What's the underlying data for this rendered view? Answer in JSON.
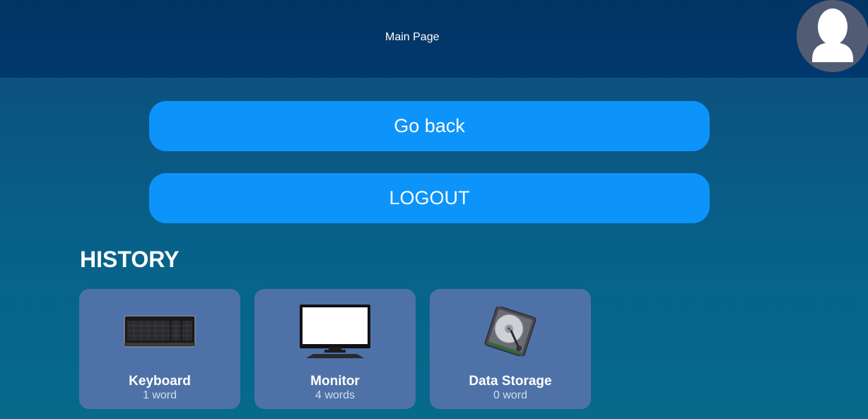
{
  "header": {
    "title": "Main Page",
    "avatar_icon": "user-silhouette-icon"
  },
  "actions": {
    "go_back_label": "Go back",
    "logout_label": "LOGOUT"
  },
  "history": {
    "heading": "HISTORY",
    "items": [
      {
        "title": "Keyboard",
        "subtitle": "1 word",
        "icon": "keyboard-icon"
      },
      {
        "title": "Monitor",
        "subtitle": "4 words",
        "icon": "monitor-icon"
      },
      {
        "title": "Data Storage",
        "subtitle": "0 word",
        "icon": "hard-drive-icon"
      }
    ]
  },
  "colors": {
    "header_bg": "#02376a",
    "page_bg": "#07628a",
    "button_bg": "#0d94fb",
    "card_bg": "#4e72a8",
    "avatar_bg": "#525b74"
  }
}
